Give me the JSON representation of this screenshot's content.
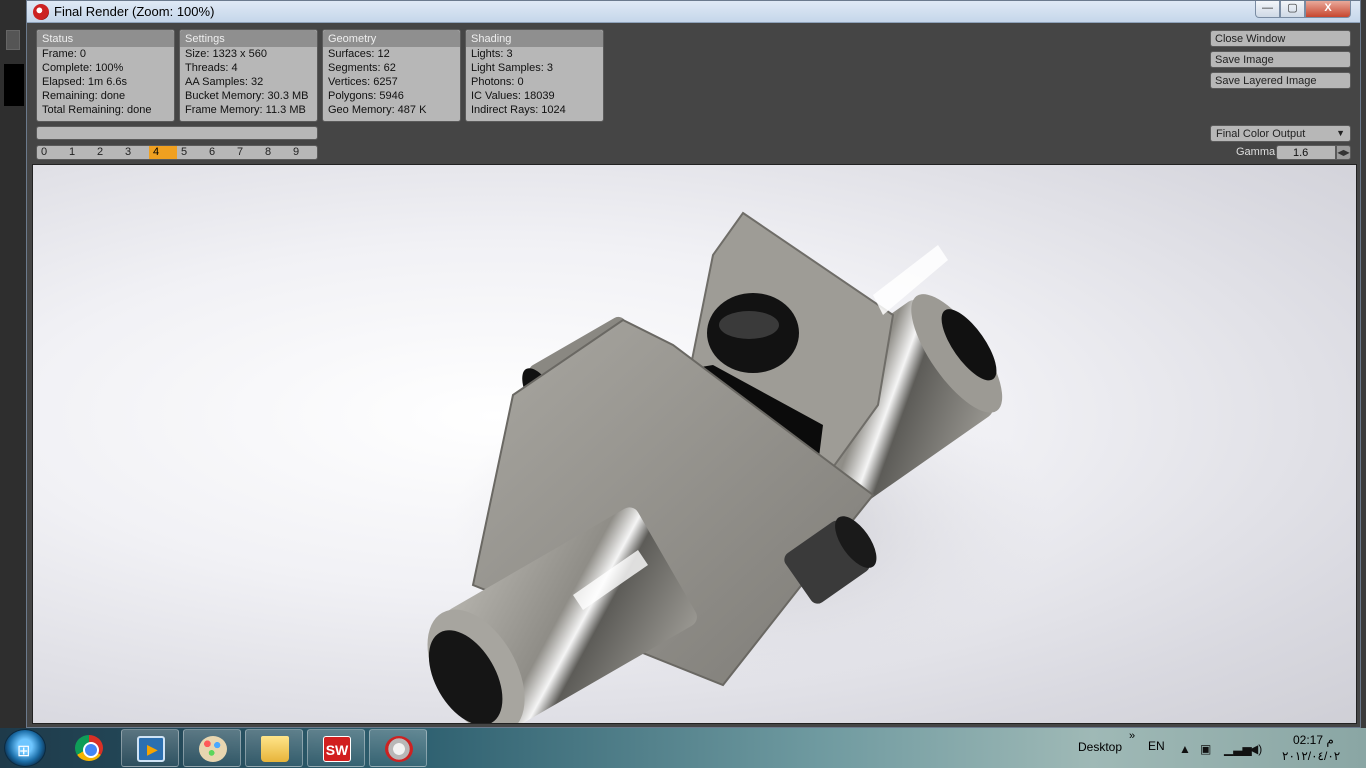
{
  "window": {
    "title": "Final Render (Zoom: 100%)",
    "minimize_glyph": "—",
    "maximize_glyph": "▢",
    "close_glyph": "X"
  },
  "panels": [
    {
      "title": "Status",
      "rows": [
        "Frame: 0",
        "Complete: 100%",
        "Elapsed: 1m 6.6s",
        "Remaining: done",
        "Total Remaining: done"
      ]
    },
    {
      "title": "Settings",
      "rows": [
        "Size: 1323 x 560",
        "Threads: 4",
        "AA Samples: 32",
        "Bucket Memory: 30.3 MB",
        "Frame Memory: 11.3 MB"
      ]
    },
    {
      "title": "Geometry",
      "rows": [
        "Surfaces: 12",
        "Segments: 62",
        "Vertices: 6257",
        "Polygons: 5946",
        "Geo Memory: 487 K"
      ]
    },
    {
      "title": "Shading",
      "rows": [
        "Lights: 3",
        "Light Samples: 3",
        "Photons: 0",
        "IC Values: 18039",
        "Indirect Rays: 1024"
      ]
    }
  ],
  "progress": {
    "value": 1.0
  },
  "frames": {
    "labels": [
      "0",
      "1",
      "2",
      "3",
      "4",
      "5",
      "6",
      "7",
      "8",
      "9"
    ],
    "active": "4"
  },
  "actions": {
    "close_window": "Close Window",
    "save_image": "Save Image",
    "save_layered_image": "Save Layered Image"
  },
  "output": {
    "selected": "Final Color Output",
    "gamma_label": "Gamma",
    "gamma_value": "1.6"
  },
  "taskbar": {
    "apps": [
      "start-orb",
      "chrome",
      "media-player",
      "paint",
      "explorer",
      "solidworks",
      "solidworks-render"
    ],
    "desktop_label": "Desktop",
    "overflow_glyph": "»",
    "lang": "EN",
    "time": "02:17 م",
    "date": "٢٠١٢/٠٤/٠٢"
  },
  "colors": {
    "active_frame": "#f0a020",
    "panel_bg": "#b7b7b7",
    "panel_header": "#8f8f8f"
  }
}
